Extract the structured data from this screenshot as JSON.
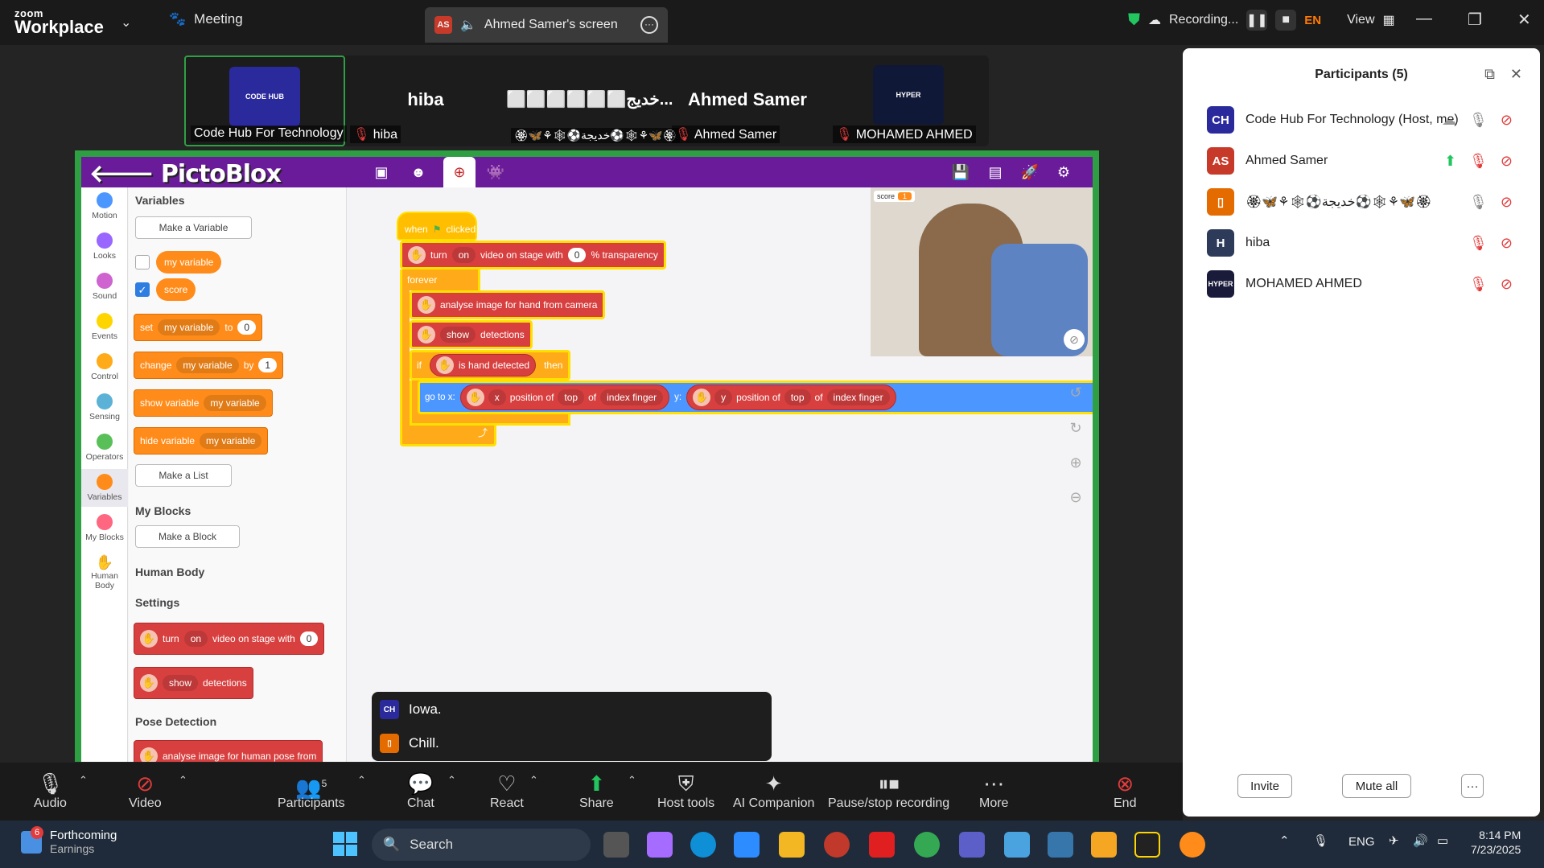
{
  "app": {
    "brand_top": "zoom",
    "brand_bottom": "Workplace",
    "meeting_tab": "Meeting",
    "screen_tab": "Ahmed Samer's screen",
    "screen_tab_badge": "AS",
    "recording_label": "Recording...",
    "lang": "EN",
    "view_label": "View"
  },
  "thumbnails": [
    {
      "name": "Code Hub For Technology",
      "logo": "CODE HUB"
    },
    {
      "name": "hiba",
      "big": "hiba"
    },
    {
      "name": "🏵🦋⚘🕸⚽خديجة⚽🕸⚘🦋🏵",
      "big": "⬜⬜⬜⬜⬜⬜خديج..."
    },
    {
      "name": "Ahmed Samer",
      "big": "Ahmed Samer"
    },
    {
      "name": "MOHAMED AHMED",
      "logo": "HYPER"
    }
  ],
  "pictoblox": {
    "title": "PictoBlox",
    "categories": [
      "Motion",
      "Looks",
      "Sound",
      "Events",
      "Control",
      "Sensing",
      "Operators",
      "Variables",
      "My Blocks",
      "Human Body"
    ],
    "category_colors": [
      "#4c97ff",
      "#9966ff",
      "#cf63cf",
      "#ffd500",
      "#ffab19",
      "#5cb1d6",
      "#59c059",
      "#ff8c1a",
      "#ff6680",
      "#d84040"
    ],
    "palette": {
      "variables_heading": "Variables",
      "make_variable": "Make a Variable",
      "var1": "my variable",
      "var2": "score",
      "set": "set",
      "set_var": "my variable",
      "to": "to",
      "set_val": "0",
      "change": "change",
      "change_var": "my variable",
      "by": "by",
      "change_val": "1",
      "show_variable": "show variable",
      "show_var": "my variable",
      "hide_variable": "hide variable",
      "hide_var": "my variable",
      "make_list": "Make a List",
      "myblocks_heading": "My Blocks",
      "make_block": "Make a Block",
      "humanbody_heading": "Human Body",
      "settings_heading": "Settings",
      "turn": "turn",
      "on": "on",
      "video_on_stage": "video on stage with",
      "zero": "0",
      "show": "show",
      "detections": "detections",
      "pose_heading": "Pose Detection",
      "analyse_pose": "analyse image for human pose from"
    },
    "script": {
      "when": "when",
      "clicked": "clicked",
      "turn": "turn",
      "on": "on",
      "video": "video on stage with",
      "trans_val": "0",
      "transparency": "% transparency",
      "forever": "forever",
      "analyse": "analyse image for hand from camera",
      "show": "show",
      "detections": "detections",
      "if": "if",
      "hand_detected": "is hand detected",
      "then": "then",
      "goto": "go to x:",
      "x": "x",
      "position_of": "position of",
      "top": "top",
      "of": "of",
      "index_finger": "index finger",
      "y_label": "y:",
      "y": "y"
    },
    "stage": {
      "score_label": "score",
      "score_value": "1"
    }
  },
  "captions": [
    {
      "text": "Iowa.",
      "badge": "CH"
    },
    {
      "text": "Chill.",
      "badge": "▯"
    }
  ],
  "toolbar": [
    {
      "label": "Audio",
      "icon": "microphone-icon"
    },
    {
      "label": "Video",
      "icon": "video-off-icon"
    },
    {
      "label": "Participants",
      "icon": "participants-icon",
      "count": "5"
    },
    {
      "label": "Chat",
      "icon": "chat-icon"
    },
    {
      "label": "React",
      "icon": "heart-icon"
    },
    {
      "label": "Share",
      "icon": "share-icon"
    },
    {
      "label": "Host tools",
      "icon": "shield-icon"
    },
    {
      "label": "AI Companion",
      "icon": "sparkle-icon"
    },
    {
      "label": "Pause/stop recording",
      "icon": "pause-stop-icon"
    },
    {
      "label": "More",
      "icon": "more-icon"
    },
    {
      "label": "End",
      "icon": "end-icon"
    }
  ],
  "participants": {
    "title": "Participants (5)",
    "list": [
      {
        "name": "Code Hub For Technology (Host, me)",
        "initials": "CH",
        "color": "#2b2a9c"
      },
      {
        "name": "Ahmed Samer",
        "initials": "AS",
        "color": "#c73a2a"
      },
      {
        "name": "🏵🦋⚘🕸⚽خديجة⚽🕸⚘🦋🏵",
        "initials": "▯",
        "color": "#e36b00"
      },
      {
        "name": "hiba",
        "initials": "H",
        "color": "#2d3a5a"
      },
      {
        "name": "MOHAMED AHMED",
        "initials": "H",
        "color": "#1a1a3a"
      }
    ],
    "invite": "Invite",
    "mute_all": "Mute all"
  },
  "taskbar": {
    "widget_count": "6",
    "widget_title": "Forthcoming",
    "widget_sub": "Earnings",
    "search": "Search",
    "lang": "ENG",
    "time": "8:14 PM",
    "date": "7/23/2025"
  }
}
